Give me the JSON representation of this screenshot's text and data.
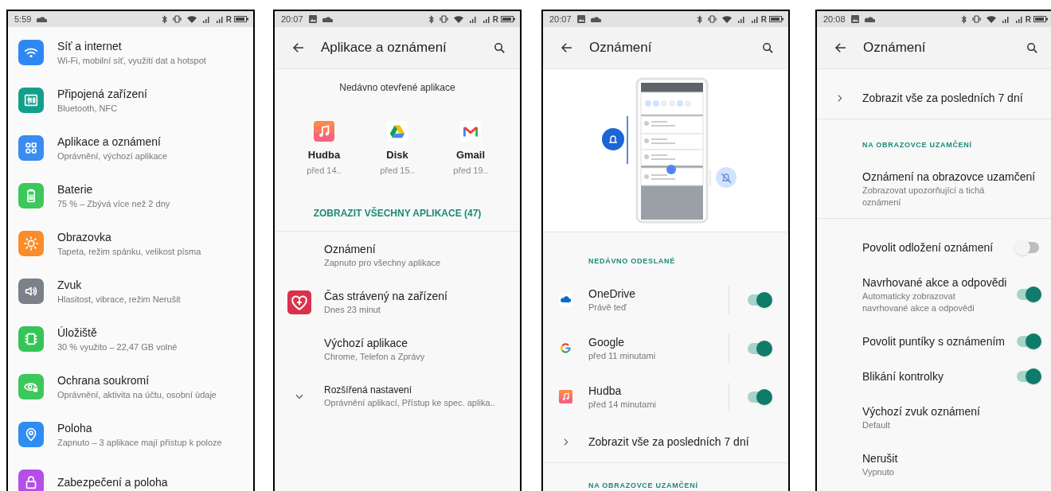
{
  "screens": [
    {
      "kind": "main",
      "status_bar": {
        "time": "5:59",
        "image_notice": false,
        "roaming": "R"
      },
      "items": [
        {
          "title": "Síť a internet",
          "subtitle": "Wi-Fi, mobilní síť, využití dat a hotspot",
          "color": "#2f88f2"
        },
        {
          "title": "Připojená zařízení",
          "subtitle": "Bluetooth, NFC",
          "color": "#12a08c"
        },
        {
          "title": "Aplikace a oznámení",
          "subtitle": "Oprávnění, výchozí aplikace",
          "color": "#3a8cf0"
        },
        {
          "title": "Baterie",
          "subtitle": "75 % – Zbývá více než 2 dny",
          "color": "#3cc85a"
        },
        {
          "title": "Obrazovka",
          "subtitle": "Tapeta, režim spánku, velikost písma",
          "color": "#fb8c2c"
        },
        {
          "title": "Zvuk",
          "subtitle": "Hlasitost, vibrace, režim Nerušit",
          "color": "#7b8089"
        },
        {
          "title": "Úložiště",
          "subtitle": "30 % využito – 22,47 GB volné",
          "color": "#36c458"
        },
        {
          "title": "Ochrana soukromí",
          "subtitle": "Oprávnění, aktivita na účtu, osobní údaje",
          "color": "#3cc85a"
        },
        {
          "title": "Poloha",
          "subtitle": "Zapnuto – 3 aplikace mají přístup k poloze",
          "color": "#2f8cf2"
        },
        {
          "title": "Zabezpečení a poloha",
          "color": "#b64ee8"
        }
      ]
    },
    {
      "kind": "apps",
      "status_bar": {
        "time": "20:07",
        "image_notice": true,
        "roaming": "R"
      },
      "title": "Aplikace a oznámení",
      "recent_title": "Nedávno otevřené aplikace",
      "recent_apps": [
        {
          "name": "Hudba",
          "time": "před 14.."
        },
        {
          "name": "Disk",
          "time": "před 15.."
        },
        {
          "name": "Gmail",
          "time": "před 19.."
        }
      ],
      "see_all": "ZOBRAZIT VŠECHNY APLIKACE (47)",
      "rows": [
        {
          "kind": "plain",
          "title": "Oznámení",
          "subtitle": "Zapnuto pro všechny aplikace"
        },
        {
          "kind": "wellbeing",
          "title": "Čas strávený na zařízení",
          "subtitle": "Dnes 23 minut"
        },
        {
          "kind": "plain",
          "title": "Výchozí aplikace",
          "subtitle": "Chrome, Telefon a Zprávy"
        },
        {
          "kind": "expand",
          "title": "Rozšířená nastavení",
          "subtitle": "Oprávnění aplikací, Přístup ke spec. aplika.."
        }
      ]
    },
    {
      "kind": "notifications",
      "status_bar": {
        "time": "20:07",
        "image_notice": true,
        "roaming": "R"
      },
      "title": "Oznámení",
      "items": [
        {
          "kind": "illustration",
          "divider": true
        },
        {
          "kind": "section",
          "title": "NEDÁVNO ODESLANÉ",
          "divider": false
        },
        {
          "kind": "app_toggle",
          "title": "OneDrive",
          "subtitle": "Právě teď",
          "on": true,
          "divider": false
        },
        {
          "kind": "app_toggle",
          "title": "Google",
          "subtitle": "před 11 minutami",
          "on": true,
          "divider": false
        },
        {
          "kind": "app_toggle",
          "title": "Hudba",
          "subtitle": "před 14 minutami",
          "on": true,
          "divider": false
        },
        {
          "kind": "link",
          "title": "Zobrazit vše za posledních 7 dní",
          "divider": true
        },
        {
          "kind": "section",
          "title": "NA OBRAZOVCE UZAMČENÍ",
          "divider": false
        }
      ]
    },
    {
      "kind": "notifications",
      "status_bar": {
        "time": "20:08",
        "image_notice": true,
        "roaming": "R"
      },
      "title": "Oznámení",
      "items": [
        {
          "kind": "link",
          "title": "Zobrazit vše za posledních 7 dní",
          "divider": true
        },
        {
          "kind": "section",
          "title": "NA OBRAZOVCE UZAMČENÍ",
          "divider": false
        },
        {
          "kind": "plain",
          "title": "Oznámení na obrazovce uzamčení",
          "subtitle": "Zobrazovat upozorňující a tichá oznámení",
          "divider": true
        },
        {
          "kind": "toggle",
          "title": "Povolit odložení oznámení",
          "on": false,
          "divider": false
        },
        {
          "kind": "toggle",
          "title": "Navrhované akce a odpovědi",
          "subtitle": "Automaticky zobrazovat navrhované akce a odpovědi",
          "on": true,
          "divider": false
        },
        {
          "kind": "toggle",
          "title": "Povolit puntíky s oznámením",
          "on": true,
          "divider": false
        },
        {
          "kind": "toggle",
          "title": "Blikání kontrolky",
          "on": true,
          "divider": false
        },
        {
          "kind": "plain",
          "title": "Výchozí zvuk oznámení",
          "subtitle": "Default",
          "divider": false
        },
        {
          "kind": "plain",
          "title": "Nerušit",
          "subtitle": "Vypnuto",
          "divider": false
        }
      ]
    }
  ]
}
